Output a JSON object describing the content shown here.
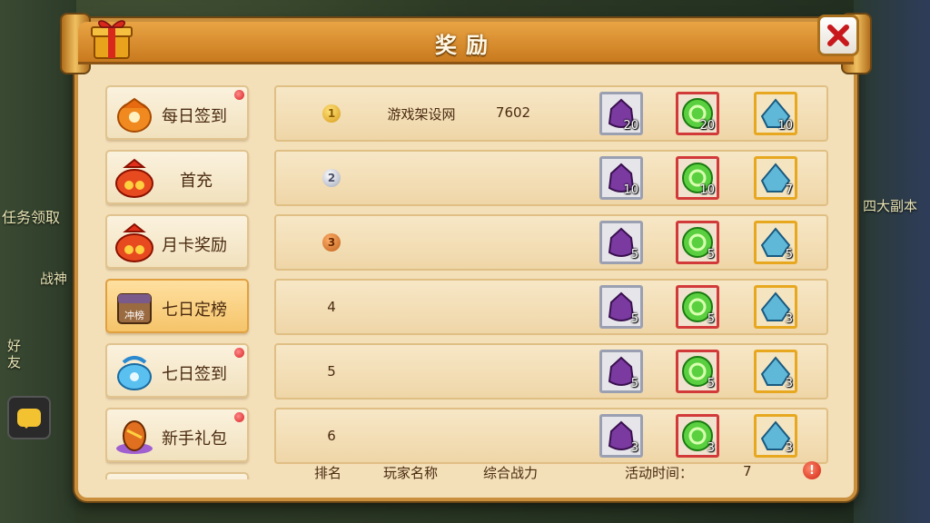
{
  "background": {
    "labels": [
      "任务领取",
      "四大副本",
      "战神",
      "好友"
    ]
  },
  "panel": {
    "title": "奖励",
    "close_icon": "close-x-icon"
  },
  "sidebar": {
    "items": [
      {
        "label": "每日签到",
        "icon": "orange-pouch-icon",
        "badge": true,
        "active": false
      },
      {
        "label": "首充",
        "icon": "money-bag-icon",
        "badge": false,
        "active": false
      },
      {
        "label": "月卡奖励",
        "icon": "money-bag-icon",
        "badge": false,
        "active": false
      },
      {
        "label": "七日定榜",
        "icon": "rank-chest-icon",
        "badge": false,
        "active": true,
        "icon_text": "冲榜"
      },
      {
        "label": "七日签到",
        "icon": "blue-pouch-icon",
        "badge": true,
        "active": false
      },
      {
        "label": "新手礼包",
        "icon": "egg-gift-icon",
        "badge": true,
        "active": false
      }
    ]
  },
  "rankings": [
    {
      "rank": "1",
      "medal": "gold",
      "player": "游戏架设网",
      "power": "7602",
      "rewards": [
        "20",
        "20",
        "10"
      ]
    },
    {
      "rank": "2",
      "medal": "silver",
      "player": "",
      "power": "",
      "rewards": [
        "10",
        "10",
        "7"
      ]
    },
    {
      "rank": "3",
      "medal": "bronze",
      "player": "",
      "power": "",
      "rewards": [
        "5",
        "5",
        "5"
      ]
    },
    {
      "rank": "4",
      "medal": "",
      "player": "",
      "power": "",
      "rewards": [
        "5",
        "5",
        "3"
      ]
    },
    {
      "rank": "5",
      "medal": "",
      "player": "",
      "power": "",
      "rewards": [
        "5",
        "5",
        "3"
      ]
    },
    {
      "rank": "6",
      "medal": "",
      "player": "",
      "power": "",
      "rewards": [
        "3",
        "3",
        "3"
      ]
    }
  ],
  "footer": {
    "rank_header": "排名",
    "player_header": "玩家名称",
    "power_header": "综合战力",
    "time_label": "活动时间：",
    "time_value": "7",
    "info_icon": "!"
  },
  "colors": {
    "panel": "#f3dfb8",
    "header": "#d98a2c",
    "item_purple_border": "#9aa0b2",
    "item_green_border": "#d23a3a",
    "item_blue_border": "#e7a820"
  }
}
